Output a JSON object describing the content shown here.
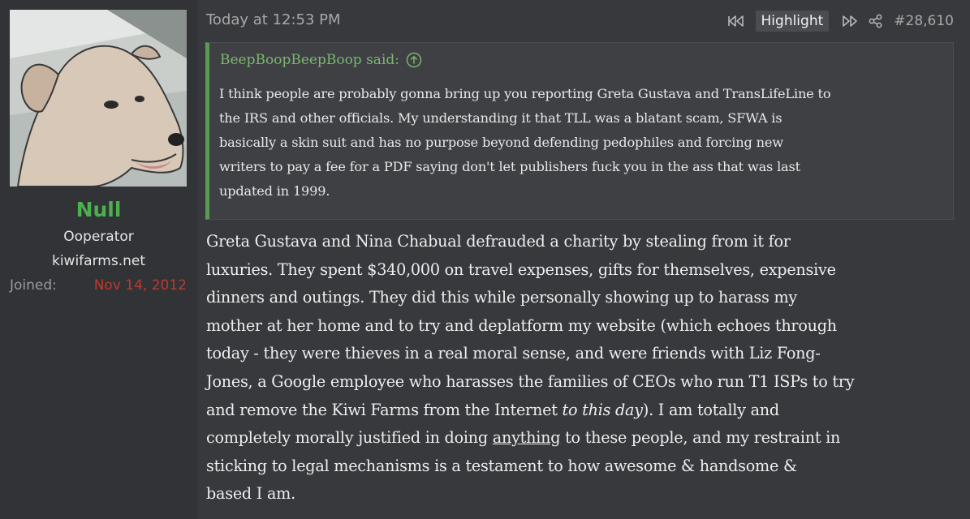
{
  "user": {
    "name": "Null",
    "title": "Ooperator",
    "site": "kiwifarms.net",
    "joined_label": "Joined:",
    "joined_value": "Nov 14, 2012"
  },
  "post": {
    "timestamp": "Today at 12:53 PM",
    "highlight_label": "Highlight",
    "number": "#28,610",
    "quote": {
      "author_said": "BeepBoopBeepBoop said:",
      "lines": [
        "I think people are probably gonna bring up you reporting Greta Gustava and TransLifeLine to",
        "the IRS and other officials. My understanding it that TLL was a blatant scam, SFWA is",
        "basically a skin suit and has no purpose beyond defending pedophiles and forcing new",
        "writers to pay a fee for a PDF saying don't let publishers fuck you in the ass that was last",
        "updated in 1999."
      ]
    },
    "body": {
      "l1": "Greta Gustava and Nina Chabual defrauded a charity by stealing from it for",
      "l2": "luxuries. They spent $340,000 on travel expenses, gifts for themselves, expensive",
      "l3": "dinners and outings. They did this while personally showing up to harass my",
      "l4": "mother at her home and to try and deplatform my website (which echoes through",
      "l5": "today - they were thieves in a real moral sense, and were friends with Liz Fong-",
      "l6": "Jones, a Google employee who harasses the families of CEOs who run T1 ISPs to try",
      "l7a": "and remove the Kiwi Farms from the Internet ",
      "l7b": "to this day",
      "l7c": "). I am totally and",
      "l8a": "completely morally justified in doing ",
      "l8b": "anything",
      "l8c": " to these people, and my restraint in",
      "l9": "sticking to legal mechanisms is a testament to how awesome & handsome &",
      "l10": "based I am."
    }
  },
  "icons": {
    "prev": "rewind-icon",
    "next": "fast-forward-icon",
    "share": "share-icon",
    "jump": "arrow-up-circle-icon"
  },
  "colors": {
    "username": "#4caf50",
    "joined": "#c0392b",
    "quote_accent": "#5b9a55"
  }
}
